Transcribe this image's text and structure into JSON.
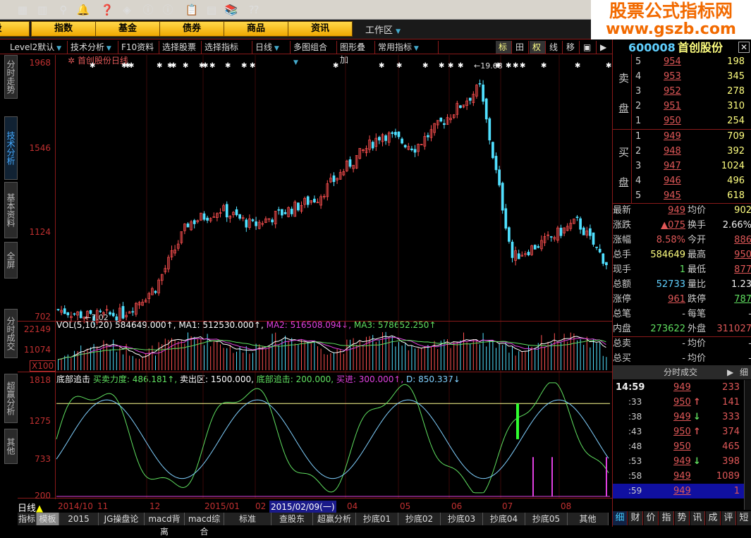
{
  "toolbar": {
    "icons": [
      "chart-icon",
      "bars-icon",
      "binoculars-icon",
      "alarm-bell-icon",
      "help-icon",
      "diamond-icon",
      "red-i-icon",
      "blue-i-icon",
      "clipboard-icon",
      "window-icon",
      "books-icon",
      "whatsthis-icon"
    ]
  },
  "nav": {
    "buttons": [
      "股",
      "指数",
      "基金",
      "债券",
      "商品",
      "资讯"
    ],
    "workspace": "工作区"
  },
  "logo": {
    "title": "股票公式指标网",
    "url": "www.gszb.com"
  },
  "menu": {
    "items": [
      "Level2默认",
      "技术分析",
      "F10资料",
      "选择股票",
      "选择指标",
      "日线",
      "多图组合",
      "图形叠加",
      "常用指标"
    ],
    "right_buttons": [
      "标",
      "田",
      "权",
      "线",
      "移",
      "▣",
      "▶"
    ]
  },
  "side_tabs": [
    "分时走势",
    "技术分析",
    "基本资料",
    "全屏",
    "分时成交",
    "超赢分析",
    "其他"
  ],
  "price_panel": {
    "title": "首创股份日线",
    "y_labels": [
      "1968",
      "1546",
      "1124",
      "702"
    ],
    "high_marker": "19.68",
    "low_marker": "7.02"
  },
  "vol_panel": {
    "legend": [
      {
        "text": "VOL(5,10,20) 584649.000↑,",
        "color": "#ffffff"
      },
      {
        "text": " MA1: 512530.000↑,",
        "color": "#ffffff"
      },
      {
        "text": " MA2: 516508.094↓,",
        "color": "#e040e0"
      },
      {
        "text": " MA3: 578652.250↑",
        "color": "#60e060"
      }
    ],
    "y_labels": [
      "22149",
      "11074"
    ],
    "unit": "X100"
  },
  "ind_panel": {
    "legend": [
      {
        "text": "底部追击",
        "color": "#ffffff"
      },
      {
        "text": " 买卖力度: 486.181↑,",
        "color": "#60e060"
      },
      {
        "text": " 卖出区: 1500.000,",
        "color": "#ffffff"
      },
      {
        "text": " 底部追击: 200.000,",
        "color": "#60e060"
      },
      {
        "text": " 买进: 300.000↑,",
        "color": "#e040e0"
      },
      {
        "text": " D: 850.337↓",
        "color": "#80d0ff"
      }
    ],
    "y_labels": [
      "1818",
      "1275",
      "733",
      "200"
    ]
  },
  "chart_data": {
    "type": "candlestick",
    "price_path": [
      740,
      705,
      720,
      850,
      1170,
      1240,
      1160,
      1230,
      1300,
      1470,
      1620,
      1550,
      1700,
      1850,
      1000,
      1080,
      1180,
      950
    ],
    "sell_zone": 1500,
    "ind_range": [
      200,
      1818
    ]
  },
  "date_axis": {
    "period": "日线",
    "labels": [
      "2014/10",
      "11",
      "12",
      "2015/01",
      "02",
      "04",
      "05",
      "06",
      "07",
      "08"
    ],
    "cursor_date": "2015/02/09(一)"
  },
  "bottom_tabs": [
    "指标",
    "模板",
    "2015",
    "JG操盘论",
    "macd背离",
    "macd综合",
    "标准",
    "查股东",
    "超赢分析",
    "抄底01",
    "抄底02",
    "抄底03",
    "抄底04",
    "抄底05",
    "其他"
  ],
  "quote": {
    "code": "600008",
    "name": "首创股份",
    "sell": [
      {
        "lvl": "5",
        "price": "954",
        "vol": "198"
      },
      {
        "lvl": "4",
        "price": "953",
        "vol": "345"
      },
      {
        "lvl": "3",
        "price": "952",
        "vol": "278"
      },
      {
        "lvl": "2",
        "price": "951",
        "vol": "310"
      },
      {
        "lvl": "1",
        "price": "950",
        "vol": "254"
      }
    ],
    "buy": [
      {
        "lvl": "1",
        "price": "949",
        "vol": "709"
      },
      {
        "lvl": "2",
        "price": "948",
        "vol": "392"
      },
      {
        "lvl": "3",
        "price": "947",
        "vol": "1024"
      },
      {
        "lvl": "4",
        "price": "946",
        "vol": "496"
      },
      {
        "lvl": "5",
        "price": "945",
        "vol": "618"
      }
    ],
    "sell_label": [
      "卖",
      "盘"
    ],
    "buy_label": [
      "买",
      "盘"
    ],
    "stats": [
      [
        "最新",
        "949",
        "均价",
        "902"
      ],
      [
        "涨跌",
        "▲075",
        "换手",
        "2.66%"
      ],
      [
        "涨幅",
        "8.58%",
        "今开",
        "886"
      ],
      [
        "总手",
        "584649",
        "最高",
        "950"
      ],
      [
        "现手",
        "1",
        "最低",
        "877"
      ],
      [
        "总额",
        "52733",
        "量比",
        "1.23"
      ],
      [
        "涨停",
        "961",
        "跌停",
        "787"
      ],
      [
        "总笔",
        "-",
        "每笔",
        "-"
      ],
      [
        "内盘",
        "273622",
        "外盘",
        "311027"
      ],
      [
        "总卖",
        "-",
        "均价",
        "-"
      ],
      [
        "总买",
        "-",
        "均价",
        "-"
      ]
    ]
  },
  "ticks": {
    "title": "分时成交",
    "detail": "细",
    "rows": [
      [
        "14:59",
        "949",
        "",
        "233"
      ],
      [
        ":33",
        "950",
        "↑",
        "141"
      ],
      [
        ":38",
        "949",
        "↓",
        "333"
      ],
      [
        ":43",
        "950",
        "↑",
        "374"
      ],
      [
        ":48",
        "950",
        "",
        "465"
      ],
      [
        ":53",
        "949",
        "↓",
        "398"
      ],
      [
        ":58",
        "949",
        "",
        "1089"
      ],
      [
        ":59",
        "949",
        "",
        "1"
      ]
    ]
  },
  "right_tabs": [
    "细",
    "财",
    "价",
    "指",
    "势",
    "讯",
    "成",
    "评",
    "短"
  ]
}
